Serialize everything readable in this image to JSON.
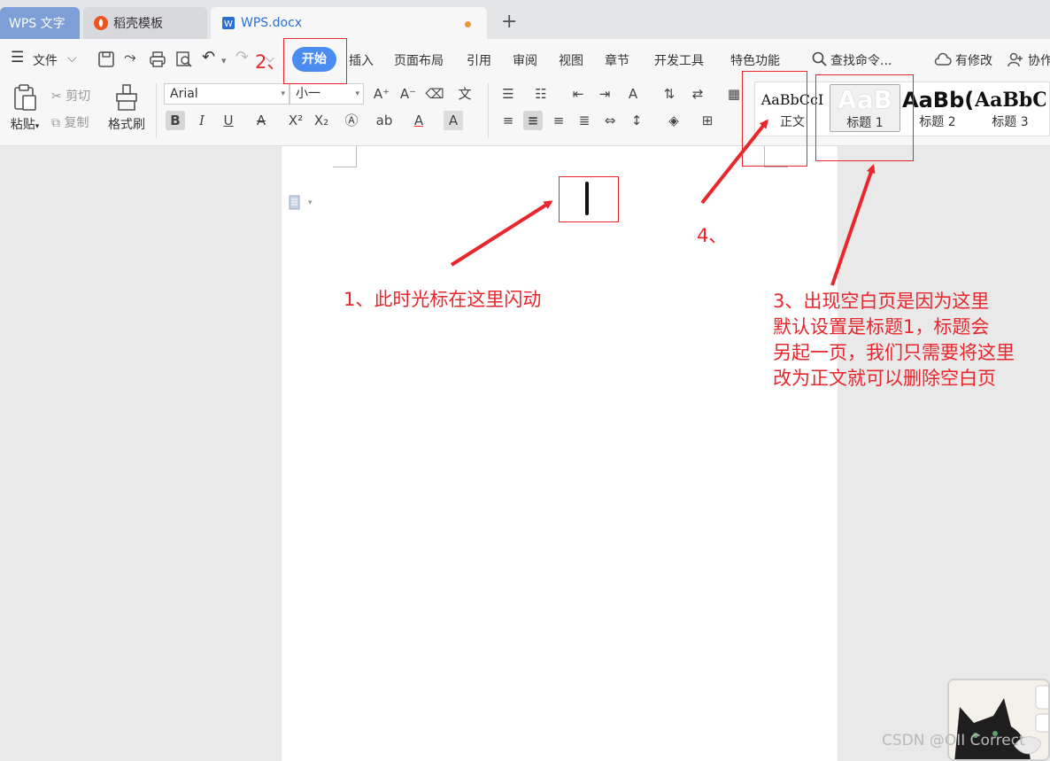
{
  "tabs": [
    {
      "label": "WPS 文字"
    },
    {
      "label": "稻壳模板"
    },
    {
      "label": "WPS.docx"
    }
  ],
  "newtab_label": "+",
  "menu": {
    "file": "文件",
    "items": [
      "开始",
      "插入",
      "页面布局",
      "引用",
      "审阅",
      "视图",
      "章节",
      "开发工具",
      "特色功能"
    ],
    "search": "查找命令...",
    "revise": "有修改",
    "collab": "协作"
  },
  "ribbon": {
    "paste": "粘贴",
    "cut": "剪切",
    "copy": "复制",
    "format_painter": "格式刷",
    "font_name": "Arial",
    "font_size": "小一",
    "styles": [
      {
        "sample": "AaBbCcI",
        "name": "正文"
      },
      {
        "sample": "AaB",
        "name": "标题 1"
      },
      {
        "sample": "AaBb(",
        "name": "标题 2"
      },
      {
        "sample": "AaBbC",
        "name": "标题 3"
      }
    ]
  },
  "annotations": {
    "step1": "1、此时光标在这里闪动",
    "step2": "2、",
    "step3": [
      "3、出现空白页是因为这里",
      "默认设置是标题1，标题会",
      "另起一页，我们只需要将这里",
      "改为正文就可以删除空白页"
    ],
    "step4": "4、"
  },
  "watermark": "CSDN @OII Correct",
  "colors": {
    "accent": "#4a8cf0",
    "annotation": "#e8262c",
    "tab_active_text": "#2b6fd6"
  }
}
